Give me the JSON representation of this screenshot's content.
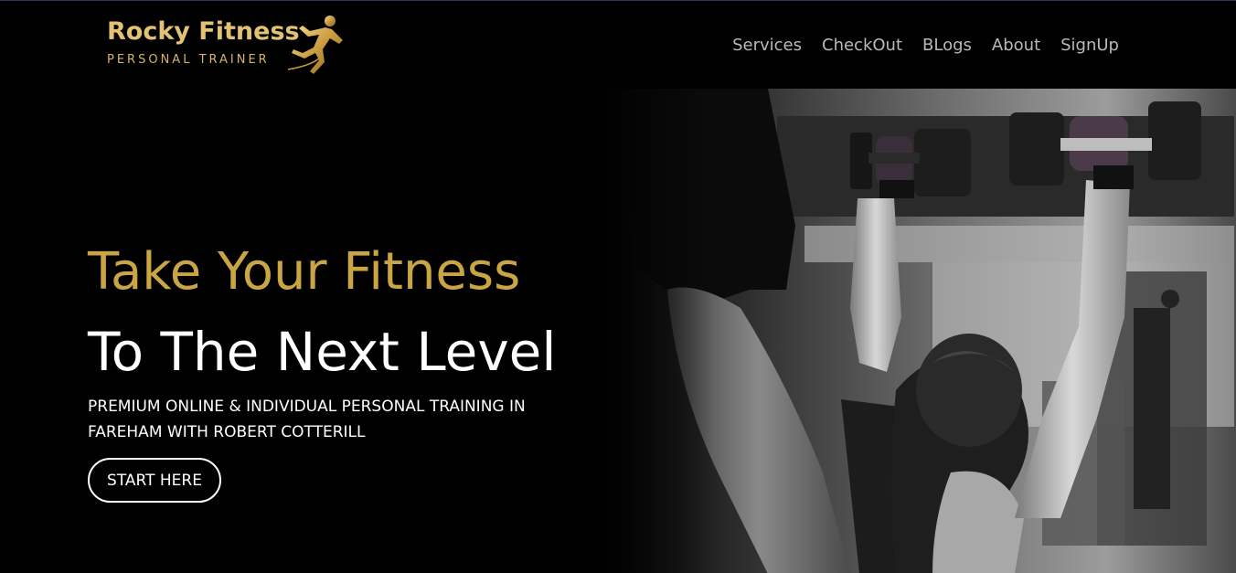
{
  "brand": {
    "name": "Rocky Fitness",
    "tagline": "PERSONAL TRAINER",
    "logo_icon": "runner-icon",
    "accent_color": "#c9a544"
  },
  "nav": {
    "items": [
      {
        "label": "Services"
      },
      {
        "label": "CheckOut"
      },
      {
        "label": "BLogs"
      },
      {
        "label": "About"
      },
      {
        "label": "SignUp"
      }
    ]
  },
  "hero": {
    "headline_line1": "Take Your Fitness",
    "headline_line2": "To The Next Level",
    "subheading": "PREMIUM ONLINE & INDIVIDUAL PERSONAL TRAINING IN FAREHAM WITH ROBERT COTTERILL",
    "cta_label": "START HERE",
    "image": "gym-training-photo"
  }
}
